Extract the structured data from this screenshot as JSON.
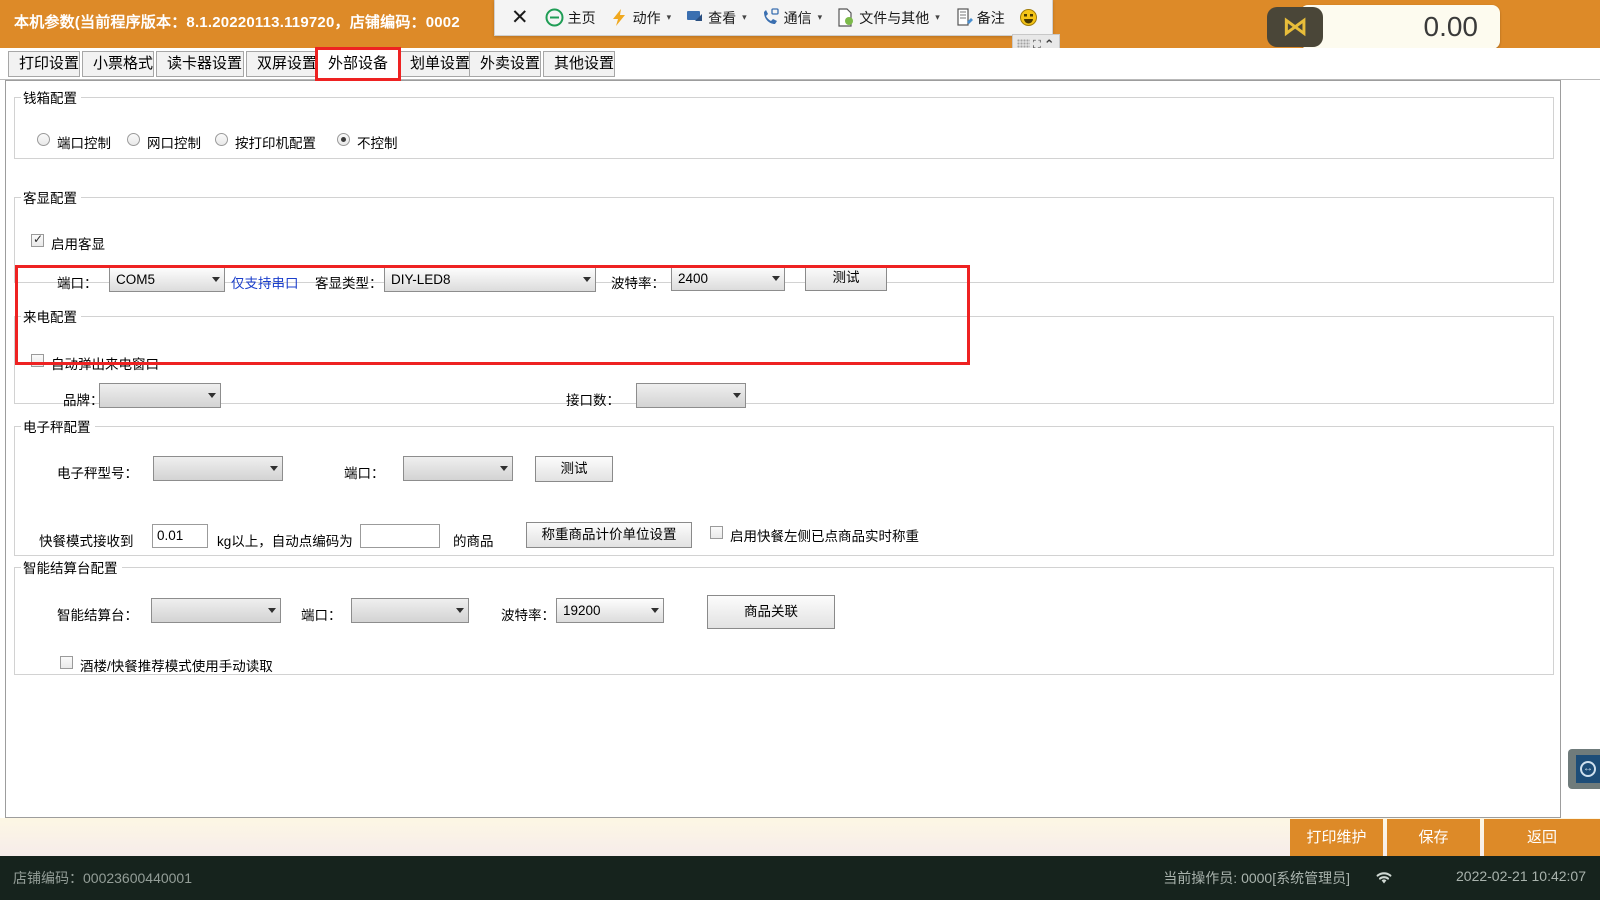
{
  "window": {
    "title": "本机参数(当前程序版本：8.1.20220113.119720，店铺编码：0002",
    "amount": "0.00",
    "logo_glyph": "⋈"
  },
  "toolbar": {
    "close_label": "✕",
    "items": [
      {
        "icon": "home-icon",
        "label": "主页",
        "caret": ""
      },
      {
        "icon": "action-icon",
        "label": "动作",
        "caret": "▾"
      },
      {
        "icon": "view-icon",
        "label": "查看",
        "caret": "▾"
      },
      {
        "icon": "phone-icon",
        "label": "通信",
        "caret": "▾"
      },
      {
        "icon": "file-icon",
        "label": "文件与其他",
        "caret": "▾"
      },
      {
        "icon": "note-icon",
        "label": "备注",
        "caret": ""
      },
      {
        "icon": "smiley-icon",
        "label": "",
        "caret": ""
      }
    ],
    "controls": {
      "grip": "drag-grip",
      "expand": "⛶",
      "collapse": "⌃"
    }
  },
  "tabs": [
    {
      "label": "打印设置",
      "active": false
    },
    {
      "label": "小票格式",
      "active": false
    },
    {
      "label": "读卡器设置",
      "active": false
    },
    {
      "label": "双屏设置",
      "active": false
    },
    {
      "label": "外部设备",
      "active": true
    },
    {
      "label": "划单设置",
      "active": false
    },
    {
      "label": "外卖设置",
      "active": false
    },
    {
      "label": "其他设置",
      "active": false
    }
  ],
  "cash_drawer": {
    "legend": "钱箱配置",
    "options": [
      {
        "label": "端口控制",
        "selected": false
      },
      {
        "label": "网口控制",
        "selected": false
      },
      {
        "label": "按打印机配置",
        "selected": false
      },
      {
        "label": "不控制",
        "selected": true
      }
    ]
  },
  "customer_display": {
    "legend": "客显配置",
    "enable_label": "启用客显",
    "enable_checked": true,
    "port_label": "端口：",
    "port_value": "COM5",
    "serial_note": "仅支持串口",
    "type_label": "客显类型：",
    "type_value": "DIY-LED8",
    "baud_label": "波特率：",
    "baud_value": "2400",
    "test_button": "测试",
    "highlight_color": "#ee2222"
  },
  "caller_id": {
    "legend": "来电配置",
    "autopopup_label": "自动弹出来电窗口",
    "autopopup_checked": false,
    "brand_label": "品牌：",
    "brand_value": "",
    "ports_label": "接口数：",
    "ports_value": ""
  },
  "scale": {
    "legend": "电子秤配置",
    "model_label": "电子秤型号：",
    "model_value": "",
    "port_label": "端口：",
    "port_value": "",
    "test_button": "测试",
    "fastfood_prefix": "快餐模式接收到",
    "weight_value": "0.01",
    "fastfood_mid": "kg以上，自动点编码为",
    "code_value": "",
    "fastfood_suffix": "的商品",
    "unit_button": "称重商品计价单位设置",
    "realtime_label": "启用快餐左侧已点商品实时称重",
    "realtime_checked": false
  },
  "smart_counter": {
    "legend": "智能结算台配置",
    "device_label": "智能结算台：",
    "device_value": "",
    "port_label": "端口：",
    "port_value": "",
    "baud_label": "波特率：",
    "baud_value": "19200",
    "link_button": "商品关联",
    "manual_label": "酒楼/快餐推荐模式使用手动读取",
    "manual_checked": false
  },
  "footer": {
    "buttons": [
      {
        "label": "打印维护"
      },
      {
        "label": "保存"
      },
      {
        "label": "返回"
      }
    ]
  },
  "statusbar": {
    "shop_code": "店铺编码：00023600440001",
    "operator": "当前操作员:  0000[系统管理员]",
    "timestamp": "2022-02-21 10:42:07",
    "wifi_icon": "wifi-icon"
  },
  "floating": {
    "remote_icon": "remote-control-icon"
  }
}
